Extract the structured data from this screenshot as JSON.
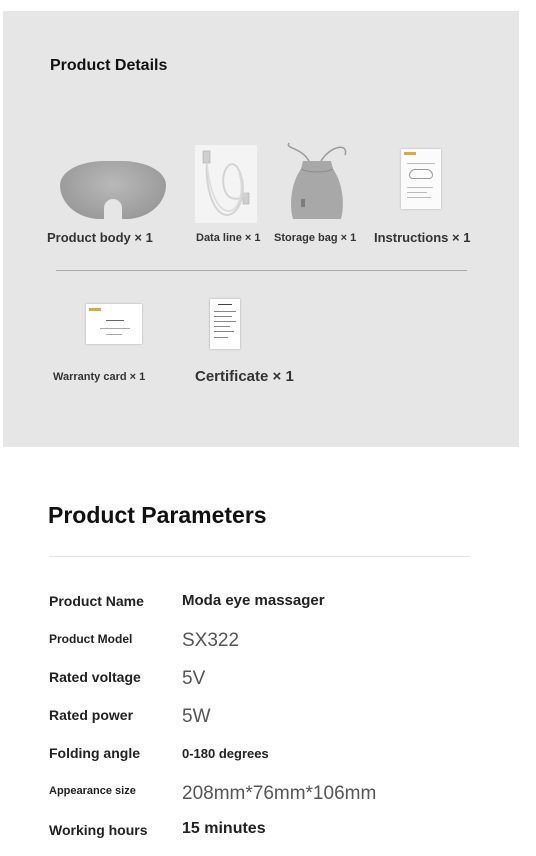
{
  "details": {
    "title": "Product Details",
    "items": [
      {
        "label": "Product body × 1",
        "icon": "eye-massager-icon"
      },
      {
        "label": "Data line × 1",
        "icon": "usb-cable-icon"
      },
      {
        "label": "Storage bag × 1",
        "icon": "drawstring-bag-icon"
      },
      {
        "label": "Instructions × 1",
        "icon": "manual-icon"
      },
      {
        "label": "Warranty card × 1",
        "icon": "warranty-card-icon"
      },
      {
        "label": "Certificate × 1",
        "icon": "certificate-icon"
      }
    ]
  },
  "parameters": {
    "title": "Product Parameters",
    "rows": [
      {
        "label": "Product Name",
        "value": "Moda eye massager"
      },
      {
        "label": "Product Model",
        "value": "SX322"
      },
      {
        "label": "Rated voltage",
        "value": "5V"
      },
      {
        "label": "Rated power",
        "value": "5W"
      },
      {
        "label": "Folding angle",
        "value": "0-180 degrees"
      },
      {
        "label": "Appearance size",
        "value": "208mm*76mm*106mm"
      },
      {
        "label": "Working hours",
        "value": "15 minutes"
      }
    ]
  },
  "colors": {
    "panel_background": "#e6e6e6",
    "accent": "#e0a640"
  }
}
